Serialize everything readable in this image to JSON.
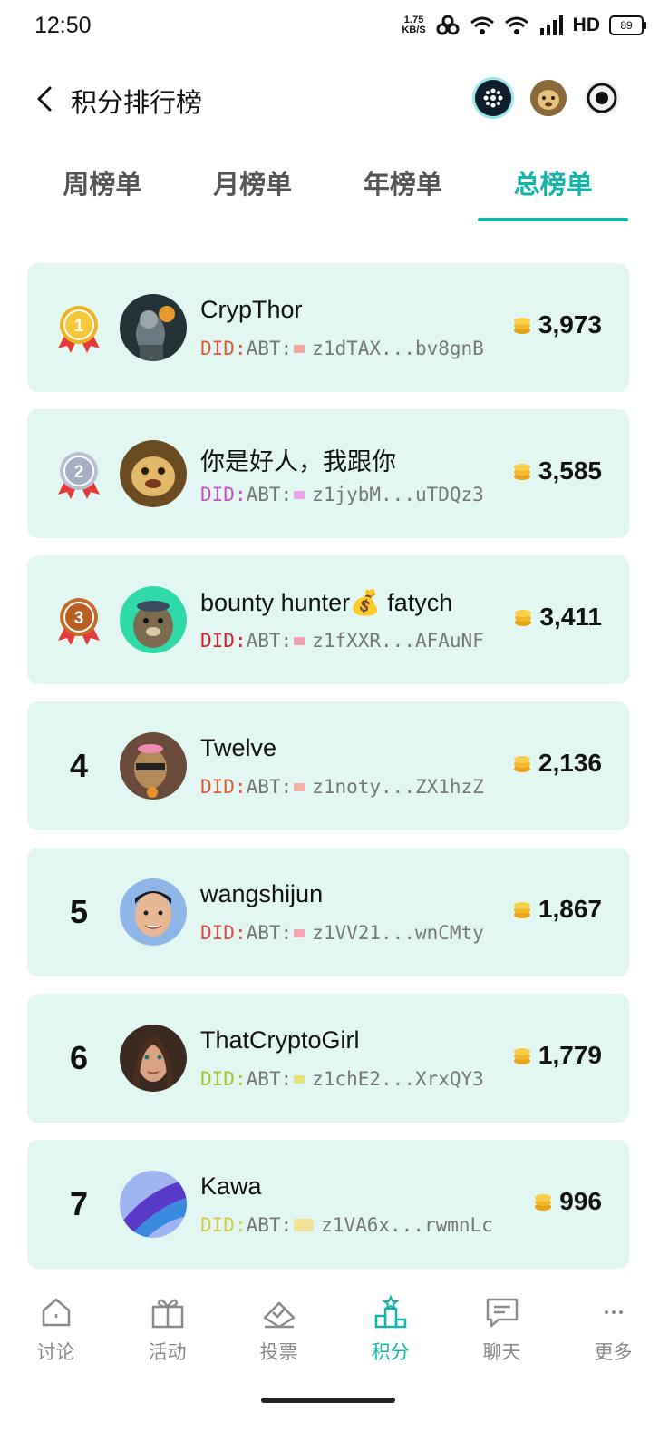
{
  "status": {
    "time": "12:50",
    "speed_top": "1.75",
    "speed_bottom": "KB/S",
    "hd": "HD",
    "battery": "89"
  },
  "header": {
    "title": "积分排行榜"
  },
  "tabs": [
    {
      "label": "周榜单"
    },
    {
      "label": "月榜单"
    },
    {
      "label": "年榜单"
    },
    {
      "label": "总榜单",
      "active": true
    }
  ],
  "did_prefix": "DID",
  "did_colon": ":",
  "did_abt": "ABT:",
  "rows": [
    {
      "rank": "1",
      "name": "CrypThor",
      "did": "z1dTAX...bv8gnB",
      "score": "3,973",
      "did_color": "#e05a3a"
    },
    {
      "rank": "2",
      "name": "你是好人，我跟你",
      "did": "z1jybM...uTDQz3",
      "score": "3,585",
      "did_color": "#c94fc9"
    },
    {
      "rank": "3",
      "name": "bounty hunter💰 fatych",
      "did": "z1fXXR...AFAuNF",
      "score": "3,411",
      "did_color": "#d4212c"
    },
    {
      "rank": "4",
      "name": "Twelve",
      "did": "z1noty...ZX1hzZ",
      "score": "2,136",
      "did_color": "#e05a3a"
    },
    {
      "rank": "5",
      "name": "wangshijun",
      "did": "z1VV21...wnCMty",
      "score": "1,867",
      "did_color": "#e04a4a"
    },
    {
      "rank": "6",
      "name": "ThatCryptoGirl",
      "did": "z1chE2...XrxQY3",
      "score": "1,779",
      "did_color": "#a8c42a"
    },
    {
      "rank": "7",
      "name": "Kawa",
      "did": "z1VA6x...rwmnLc",
      "score": "996",
      "did_color": "#d7c94a"
    }
  ],
  "nav": [
    {
      "label": "讨论",
      "icon": "home-icon"
    },
    {
      "label": "活动",
      "icon": "gift-icon"
    },
    {
      "label": "投票",
      "icon": "vote-icon"
    },
    {
      "label": "积分",
      "icon": "podium-icon",
      "active": true
    },
    {
      "label": "聊天",
      "icon": "chat-icon"
    },
    {
      "label": "更多",
      "icon": "more-icon"
    }
  ],
  "colors": {
    "accent": "#13b5a8",
    "card_bg": "#e2f6f2",
    "gold": "#f2b01e",
    "silver": "#b9c0d3",
    "bronze": "#c56a2b"
  }
}
